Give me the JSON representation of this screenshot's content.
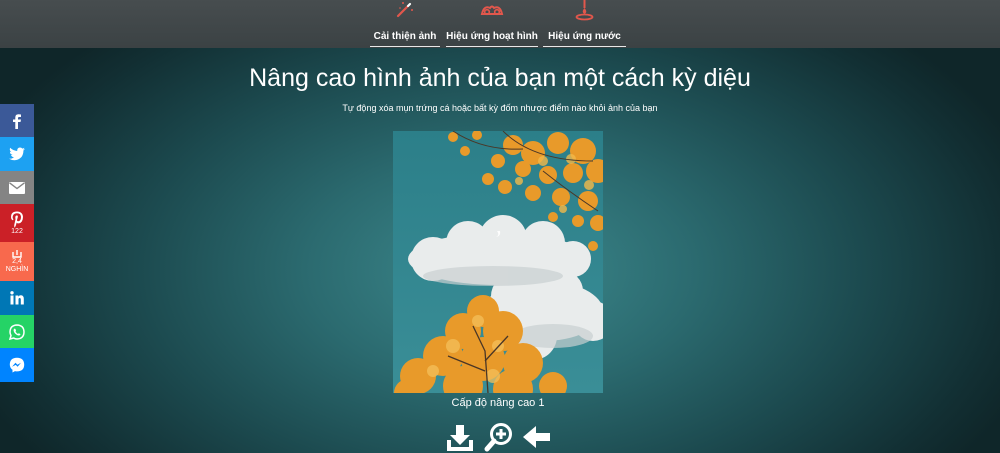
{
  "tabs": [
    {
      "label": "Cải thiện ảnh",
      "icon": "magic-wand-icon"
    },
    {
      "label": "Hiệu ứng hoạt hình",
      "icon": "cartoon-eyes-icon"
    },
    {
      "label": "Hiệu ứng nước",
      "icon": "water-drop-icon"
    }
  ],
  "main": {
    "title": "Nâng cao hình ảnh của bạn một cách kỳ diệu",
    "subtitle": "Tự động xóa mụn trứng cá hoặc bất kỳ đốm nhược điểm nào khỏi ảnh của bạn",
    "image_caption": "Cấp độ nâng cao 1"
  },
  "actions": [
    {
      "icon": "download-icon"
    },
    {
      "icon": "zoom-in-icon"
    },
    {
      "icon": "back-arrow-icon"
    }
  ],
  "share": {
    "facebook": {
      "icon": "facebook-icon",
      "color": "#3b5998"
    },
    "twitter": {
      "icon": "twitter-icon",
      "color": "#1da1f2"
    },
    "email": {
      "icon": "email-icon",
      "color": "#848484"
    },
    "pinterest": {
      "icon": "pinterest-icon",
      "color": "#cb2027",
      "count": "122"
    },
    "addthis": {
      "icon": "share-plus-icon",
      "color": "#f8694d",
      "count_top": "2,4",
      "count_bottom": "NGHÌN"
    },
    "linkedin": {
      "icon": "linkedin-icon",
      "color": "#0077b5"
    },
    "whatsapp": {
      "icon": "whatsapp-icon",
      "color": "#25d366"
    },
    "messenger": {
      "icon": "messenger-icon",
      "color": "#0084ff"
    }
  },
  "colors": {
    "accent": "#e2574c",
    "topbar": "#424a4c",
    "background_center": "#3d8a8e",
    "background_edge": "#0f2629"
  }
}
